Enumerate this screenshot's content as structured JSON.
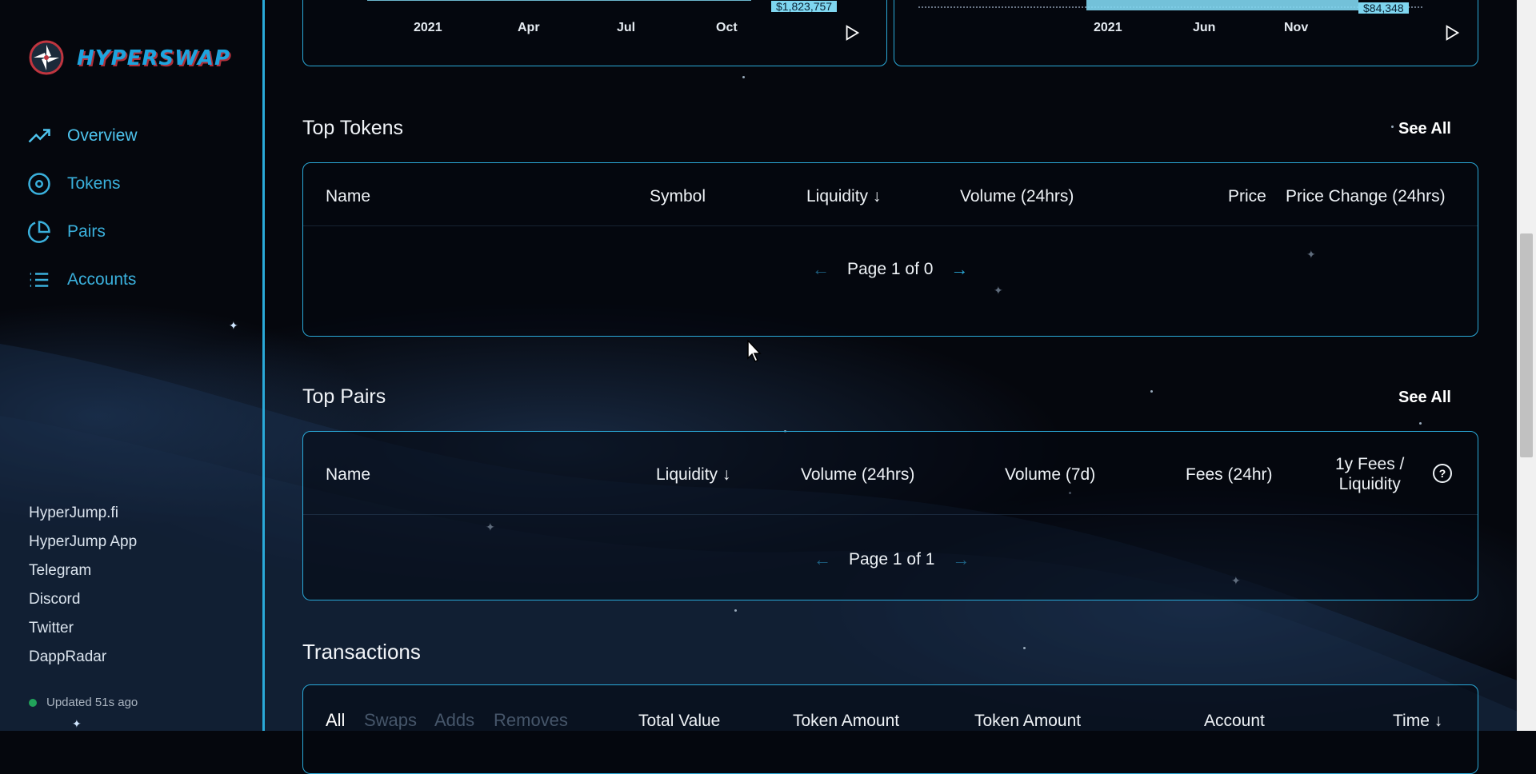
{
  "brand": {
    "name": "HYPERSWAP"
  },
  "nav": [
    {
      "label": "Overview",
      "icon": "trending-up-icon"
    },
    {
      "label": "Tokens",
      "icon": "disc-icon"
    },
    {
      "label": "Pairs",
      "icon": "pie-chart-icon"
    },
    {
      "label": "Accounts",
      "icon": "list-icon"
    }
  ],
  "links": [
    "HyperJump.fi",
    "HyperJump App",
    "Telegram",
    "Discord",
    "Twitter",
    "DappRadar"
  ],
  "status": {
    "updated": "Updated 51s ago",
    "color": "#21a35a"
  },
  "charts": {
    "left": {
      "ticks": [
        "2021",
        "Apr",
        "Jul",
        "Oct"
      ],
      "value_label": "$1,823,757"
    },
    "right": {
      "ticks": [
        "2021",
        "Jun",
        "Nov"
      ],
      "value_label": "$84,348"
    }
  },
  "top_tokens": {
    "title": "Top Tokens",
    "see_all": "See All",
    "columns": [
      "Name",
      "Symbol",
      "Liquidity ↓",
      "Volume (24hrs)",
      "Price",
      "Price Change (24hrs)"
    ],
    "pager": "Page 1 of 0"
  },
  "top_pairs": {
    "title": "Top Pairs",
    "see_all": "See All",
    "columns": [
      "Name",
      "Liquidity ↓",
      "Volume (24hrs)",
      "Volume (7d)",
      "Fees (24hr)",
      "1y Fees /",
      "Liquidity"
    ],
    "help_icon": "question-circle-icon",
    "pager": "Page 1 of 1"
  },
  "transactions": {
    "title": "Transactions",
    "tabs": [
      "All",
      "Swaps",
      "Adds",
      "Removes"
    ],
    "columns": [
      "Total Value",
      "Token Amount",
      "Token Amount",
      "Account",
      "Time ↓"
    ]
  },
  "colors": {
    "accent": "#2aa9d8",
    "background": "#05070d"
  }
}
